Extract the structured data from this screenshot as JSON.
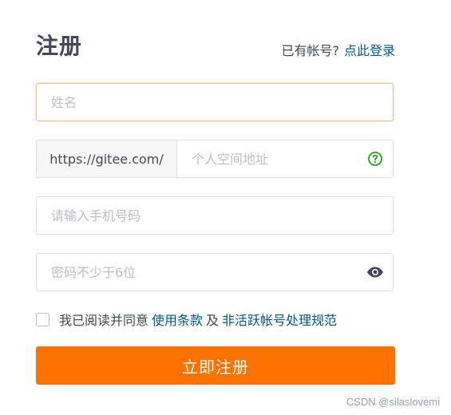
{
  "header": {
    "title": "注册",
    "have_account_text": "已有帐号?",
    "login_link": "点此登录"
  },
  "form": {
    "name": {
      "placeholder": "姓名",
      "value": ""
    },
    "space": {
      "prefix": "https://gitee.com/",
      "placeholder": "个人空间地址",
      "value": "",
      "help_icon": "question-circle-icon"
    },
    "phone": {
      "placeholder": "请输入手机号码",
      "value": ""
    },
    "password": {
      "placeholder": "密码不少于6位",
      "value": "",
      "toggle_icon": "eye-icon"
    },
    "agreement": {
      "checked": false,
      "text_before": "我已阅读并同意",
      "terms_link": "使用条款",
      "conjunction": "及",
      "policy_link": "非活跃帐号处理规范"
    },
    "submit_label": "立即注册"
  },
  "colors": {
    "accent": "#fe7300",
    "link": "#005980",
    "text": "#40485b",
    "focus_border": "#f2c08e",
    "help_icon": "#23a31d"
  },
  "watermark": "CSDN @silaslovemi"
}
